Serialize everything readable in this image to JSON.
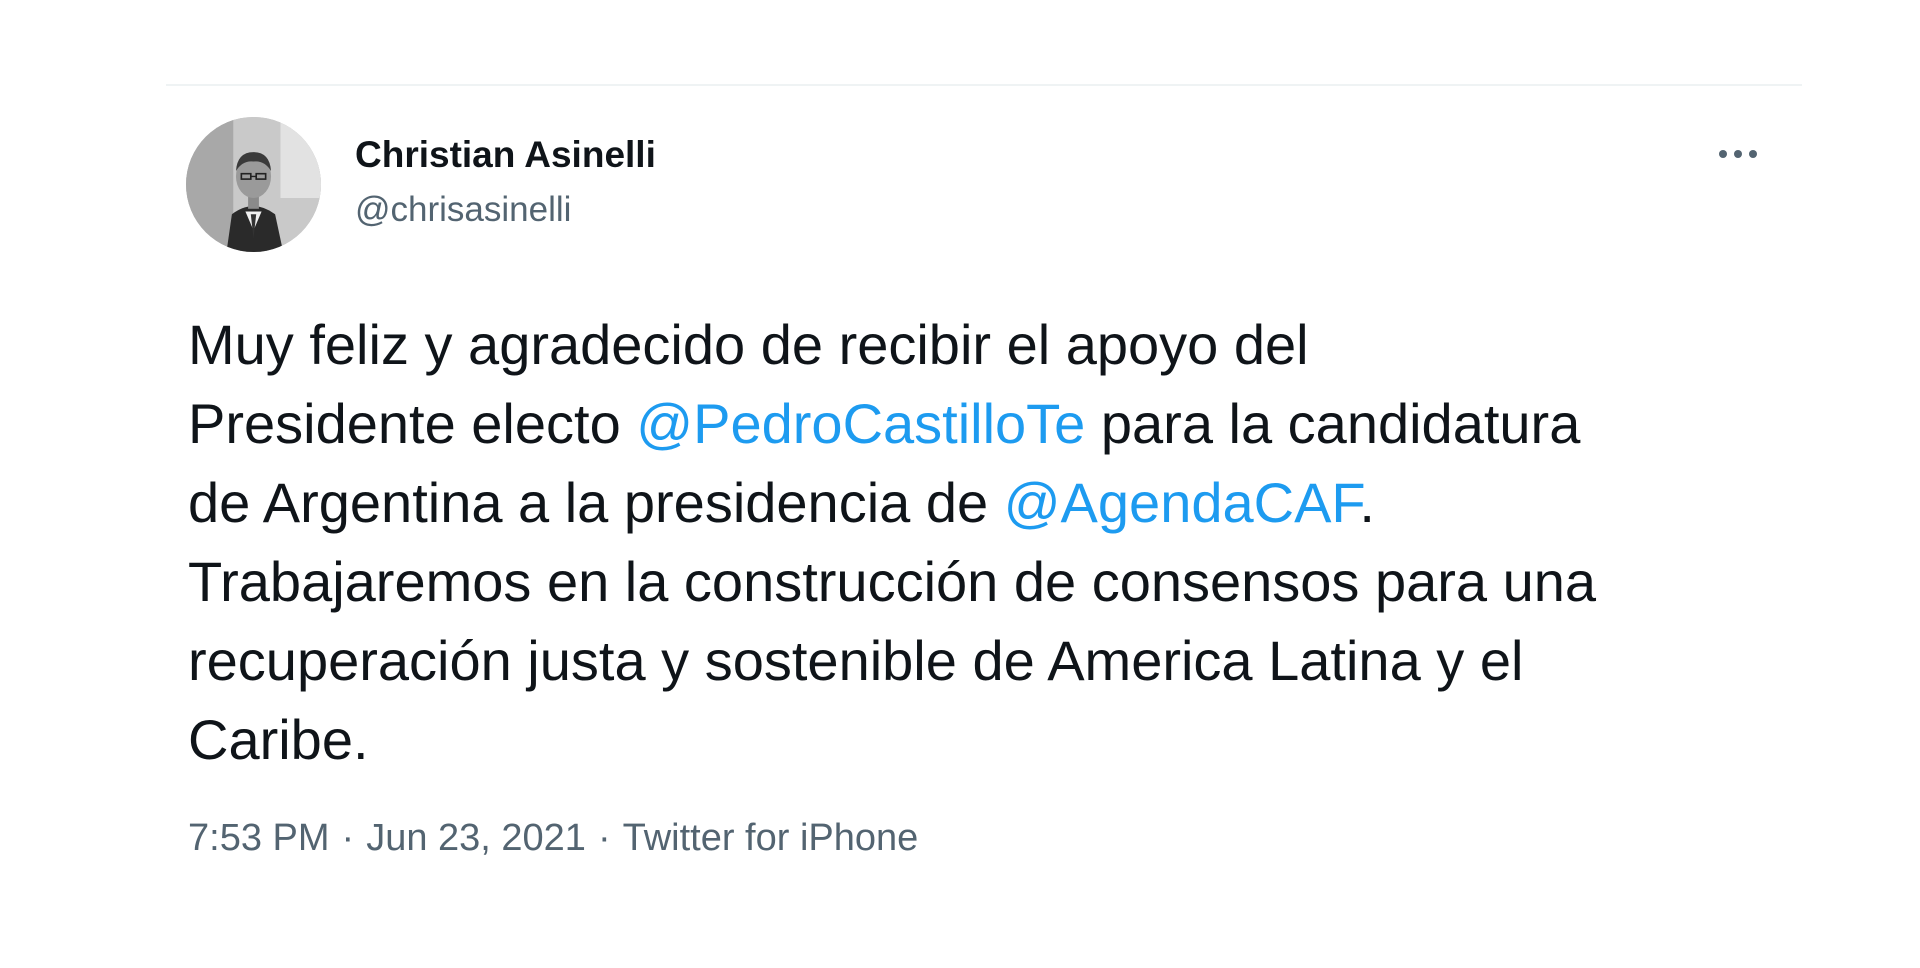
{
  "author": {
    "name": "Christian Asinelli",
    "handle": "@chrisasinelli"
  },
  "more_icon": "more-horizontal-icon",
  "tweet": {
    "line1": "Muy feliz y agradecido de recibir el apoyo del",
    "line2_before": "Presidente electo ",
    "mention1": "@PedroCastilloTe",
    "line2_after": " para la candidatura",
    "line3_before": "de Argentina a la presidencia de ",
    "mention2": "@AgendaCAF",
    "line3_after": ".",
    "line4": "Trabajaremos en la construcción de consensos para una",
    "line5": "recuperación justa y sostenible de America Latina y el",
    "line6": "Caribe."
  },
  "meta": {
    "time": "7:53 PM",
    "separator": "·",
    "date": "Jun 23, 2021",
    "source": "Twitter for iPhone"
  },
  "colors": {
    "mention": "#1d9bf0",
    "text": "#0f1419",
    "secondary": "#536471"
  }
}
